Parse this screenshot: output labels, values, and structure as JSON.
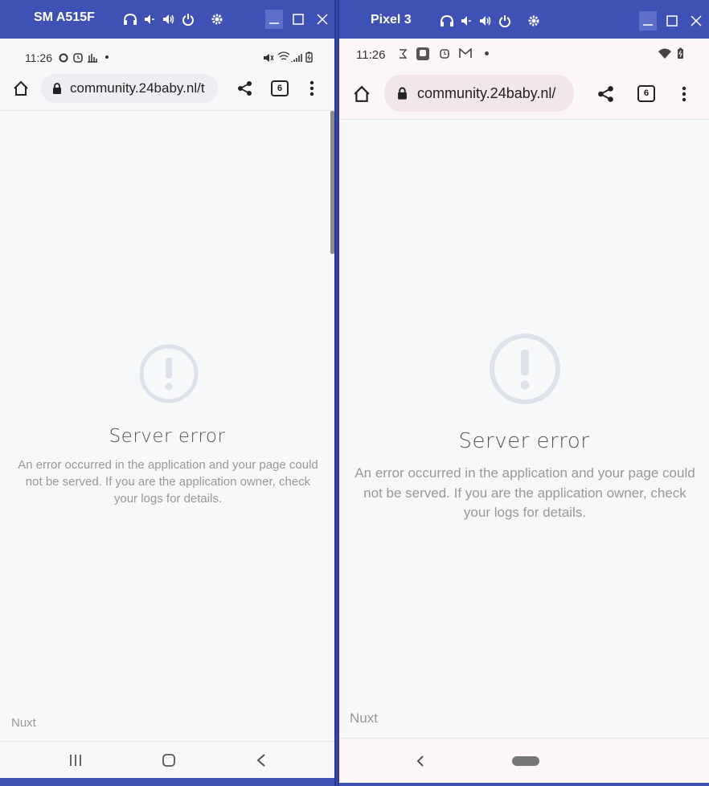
{
  "left": {
    "device_name": "SM A515F",
    "status": {
      "time": "11:26"
    },
    "browser": {
      "url": "community.24baby.nl/t",
      "tab_count": "6"
    },
    "page": {
      "title": "Server error",
      "message": "An error occurred in the application and your page could not be served. If you are the application owner, check your logs for details.",
      "footer": "Nuxt"
    }
  },
  "right": {
    "device_name": "Pixel 3",
    "status": {
      "time": "11:26"
    },
    "browser": {
      "url": "community.24baby.nl/",
      "tab_count": "6"
    },
    "page": {
      "title": "Server error",
      "message": "An error occurred in the application and your page could not be served. If you are the application owner, check your logs for details.",
      "footer": "Nuxt"
    }
  },
  "colors": {
    "titlebar": "#3f51b5",
    "icon_circle": "#dde1ea",
    "page_bg": "#f7f8fa"
  }
}
